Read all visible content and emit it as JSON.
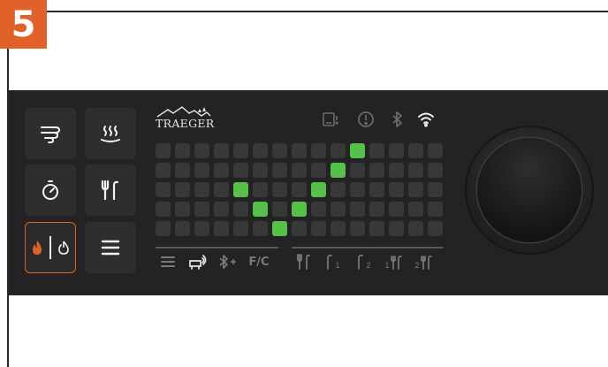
{
  "step": {
    "number": "5",
    "color": "#e0622a"
  },
  "panel": {
    "background": "#232323"
  },
  "brand": {
    "name": "TRAEGER"
  },
  "left_tiles": [
    {
      "icon": "smoke-icon",
      "active": false
    },
    {
      "icon": "keep-warm-icon",
      "active": false
    },
    {
      "icon": "timer-icon",
      "active": false
    },
    {
      "icon": "probe-icon",
      "active": false
    },
    {
      "icon": "ignite-power-icon",
      "active": true
    },
    {
      "icon": "menu-icon",
      "active": false
    }
  ],
  "status_icons": [
    "pellet-sensor-icon",
    "alert-icon",
    "bluetooth-icon",
    "wifi-icon"
  ],
  "display": {
    "columns": 15,
    "rows": 5,
    "lit_color": "#57c04d",
    "lit_cells": [
      [
        10,
        0
      ],
      [
        9,
        1
      ],
      [
        4,
        2
      ],
      [
        8,
        2
      ],
      [
        5,
        3
      ],
      [
        7,
        3
      ],
      [
        6,
        4
      ]
    ]
  },
  "bottom_icons_left": [
    "menu-icon",
    "grill-connect-icon",
    "bluetooth-pair-icon"
  ],
  "unit_label": "F/C",
  "probe_labels": {
    "probe1": "1",
    "probe2": "2",
    "combo1": "1",
    "combo2": "2"
  },
  "knob": {
    "type": "dial"
  }
}
